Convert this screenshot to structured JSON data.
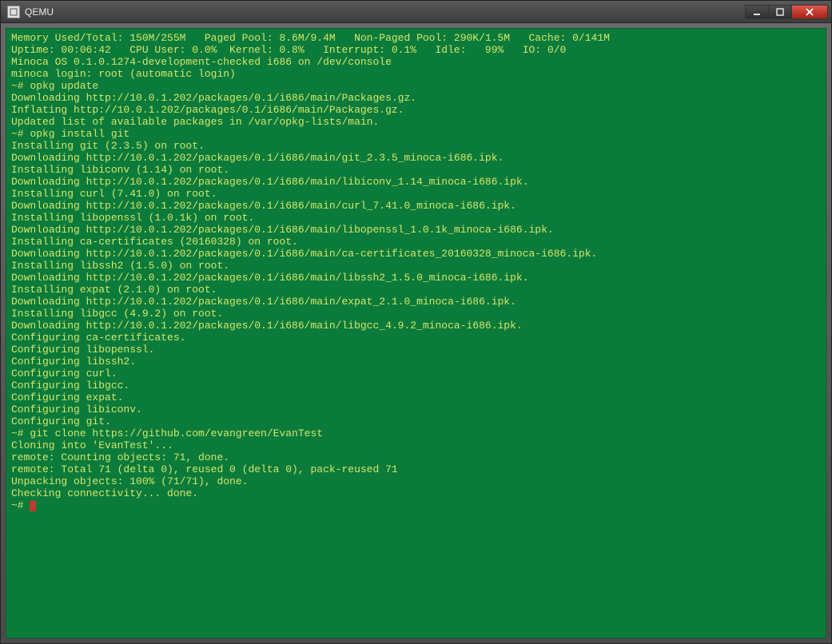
{
  "window": {
    "title": "QEMU"
  },
  "terminal": {
    "lines": [
      "Memory Used/Total: 150M/255M   Paged Pool: 8.6M/9.4M   Non-Paged Pool: 290K/1.5M   Cache: 0/141M",
      "Uptime: 00:06:42   CPU User: 0.0%  Kernel: 0.8%   Interrupt: 0.1%   Idle:   99%   IO: 0/0",
      "",
      "Minoca OS 0.1.0.1274-development-checked i686 on /dev/console",
      "",
      "minoca login: root (automatic login)",
      "~# opkg update",
      "Downloading http://10.0.1.202/packages/0.1/i686/main/Packages.gz.",
      "Inflating http://10.0.1.202/packages/0.1/i686/main/Packages.gz.",
      "Updated list of available packages in /var/opkg-lists/main.",
      "~# opkg install git",
      "Installing git (2.3.5) on root.",
      "Downloading http://10.0.1.202/packages/0.1/i686/main/git_2.3.5_minoca-i686.ipk.",
      "Installing libiconv (1.14) on root.",
      "Downloading http://10.0.1.202/packages/0.1/i686/main/libiconv_1.14_minoca-i686.ipk.",
      "Installing curl (7.41.0) on root.",
      "Downloading http://10.0.1.202/packages/0.1/i686/main/curl_7.41.0_minoca-i686.ipk.",
      "Installing libopenssl (1.0.1k) on root.",
      "Downloading http://10.0.1.202/packages/0.1/i686/main/libopenssl_1.0.1k_minoca-i686.ipk.",
      "Installing ca-certificates (20160328) on root.",
      "Downloading http://10.0.1.202/packages/0.1/i686/main/ca-certificates_20160328_minoca-i686.ipk.",
      "Installing libssh2 (1.5.0) on root.",
      "Downloading http://10.0.1.202/packages/0.1/i686/main/libssh2_1.5.0_minoca-i686.ipk.",
      "Installing expat (2.1.0) on root.",
      "Downloading http://10.0.1.202/packages/0.1/i686/main/expat_2.1.0_minoca-i686.ipk.",
      "Installing libgcc (4.9.2) on root.",
      "Downloading http://10.0.1.202/packages/0.1/i686/main/libgcc_4.9.2_minoca-i686.ipk.",
      "Configuring ca-certificates.",
      "Configuring libopenssl.",
      "Configuring libssh2.",
      "Configuring curl.",
      "Configuring libgcc.",
      "Configuring expat.",
      "Configuring libiconv.",
      "Configuring git.",
      "~# git clone https://github.com/evangreen/EvanTest",
      "Cloning into 'EvanTest'...",
      "remote: Counting objects: 71, done.",
      "remote: Total 71 (delta 0), reused 0 (delta 0), pack-reused 71",
      "Unpacking objects: 100% (71/71), done.",
      "Checking connectivity... done.",
      "~# "
    ]
  }
}
